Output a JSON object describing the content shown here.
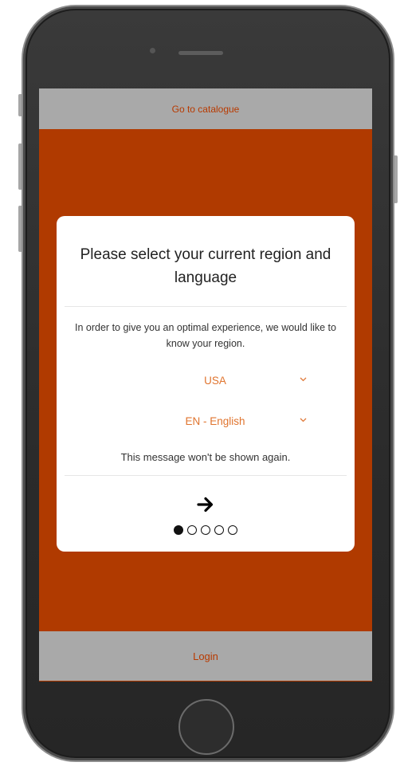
{
  "header": {
    "catalogue_link": "Go to catalogue"
  },
  "modal": {
    "title": "Please select your current region and language",
    "description": "In order to give you an optimal experience, we would like to know your region.",
    "region_select": {
      "value": "USA",
      "icon": "chevron-down-icon"
    },
    "language_select": {
      "value": "EN - English",
      "icon": "chevron-down-icon"
    },
    "note": "This message won't be shown again.",
    "next_icon": "arrow-right-icon",
    "pager": {
      "total": 5,
      "active_index": 0
    }
  },
  "footer": {
    "login_label": "Login"
  },
  "colors": {
    "brand_orange": "#b03a00",
    "bar_gray": "#a9a9a9",
    "link_text": "#b83a00",
    "select_text": "#e0742e"
  }
}
